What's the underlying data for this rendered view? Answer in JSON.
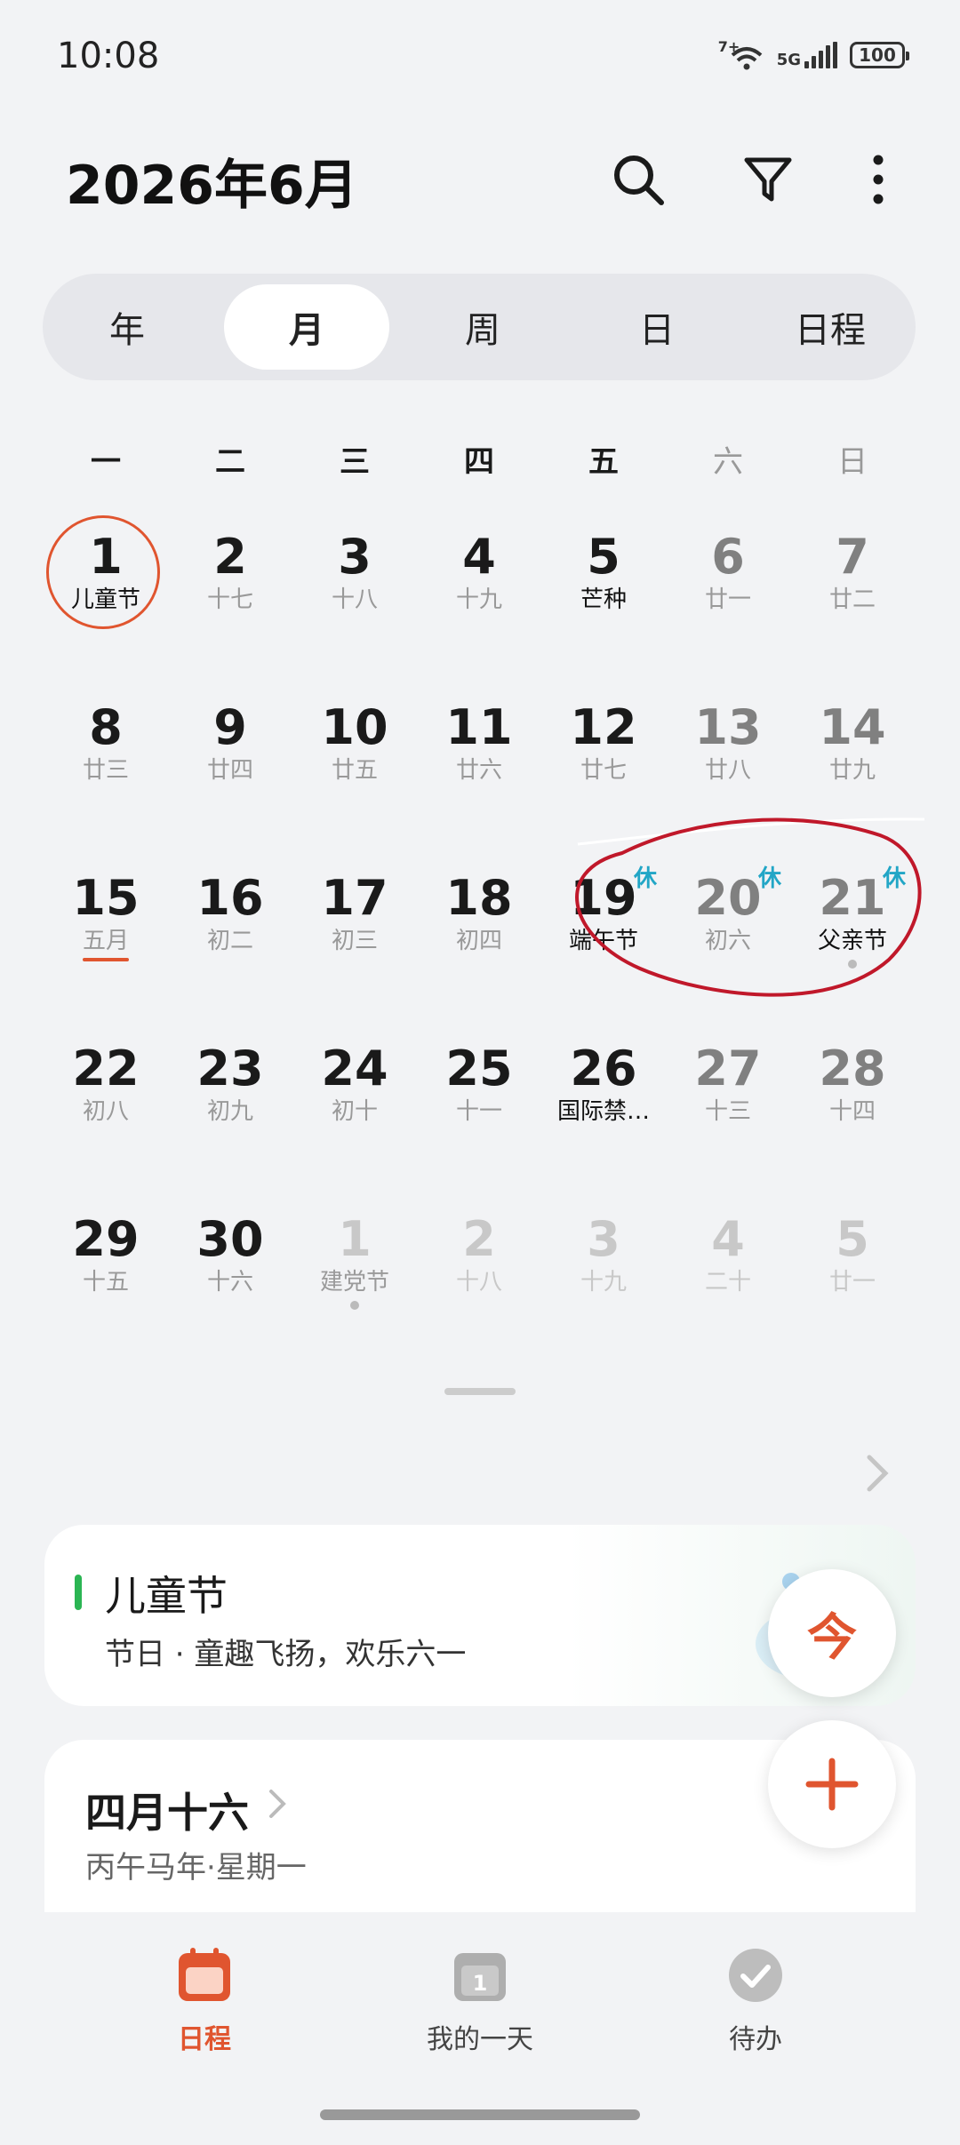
{
  "status_bar": {
    "time": "10:08",
    "wifi_sup": "7+",
    "net": "5G",
    "battery": "100"
  },
  "header": {
    "title": "2026年6月",
    "icons": [
      "search-icon",
      "filter-icon",
      "more-icon"
    ]
  },
  "view_tabs": {
    "items": [
      "年",
      "月",
      "周",
      "日",
      "日程"
    ],
    "selected": "月"
  },
  "weekdays": [
    "一",
    "二",
    "三",
    "四",
    "五",
    "六",
    "日"
  ],
  "calendar": {
    "weeks": [
      [
        {
          "day": "1",
          "sub": "儿童节",
          "sub_dark": true,
          "today": true
        },
        {
          "day": "2",
          "sub": "十七"
        },
        {
          "day": "3",
          "sub": "十八"
        },
        {
          "day": "4",
          "sub": "十九"
        },
        {
          "day": "5",
          "sub": "芒种",
          "sub_dark": true
        },
        {
          "day": "6",
          "sub": "廿一"
        },
        {
          "day": "7",
          "sub": "廿二"
        }
      ],
      [
        {
          "day": "8",
          "sub": "廿三"
        },
        {
          "day": "9",
          "sub": "廿四"
        },
        {
          "day": "10",
          "sub": "廿五"
        },
        {
          "day": "11",
          "sub": "廿六"
        },
        {
          "day": "12",
          "sub": "廿七"
        },
        {
          "day": "13",
          "sub": "廿八"
        },
        {
          "day": "14",
          "sub": "廿九"
        }
      ],
      [
        {
          "day": "15",
          "sub": "五月",
          "underline": true
        },
        {
          "day": "16",
          "sub": "初二"
        },
        {
          "day": "17",
          "sub": "初三"
        },
        {
          "day": "18",
          "sub": "初四"
        },
        {
          "day": "19",
          "sub": "端午节",
          "sub_dark": true,
          "rest": "休"
        },
        {
          "day": "20",
          "sub": "初六",
          "rest": "休"
        },
        {
          "day": "21",
          "sub": "父亲节",
          "sub_dark": true,
          "rest": "休",
          "dot": true
        }
      ],
      [
        {
          "day": "22",
          "sub": "初八"
        },
        {
          "day": "23",
          "sub": "初九"
        },
        {
          "day": "24",
          "sub": "初十"
        },
        {
          "day": "25",
          "sub": "十一"
        },
        {
          "day": "26",
          "sub": "国际禁…",
          "sub_dark": true
        },
        {
          "day": "27",
          "sub": "十三"
        },
        {
          "day": "28",
          "sub": "十四"
        }
      ],
      [
        {
          "day": "29",
          "sub": "十五"
        },
        {
          "day": "30",
          "sub": "十六"
        },
        {
          "day": "1",
          "sub": "建党节",
          "sub_dark": true,
          "other": true,
          "dot": true
        },
        {
          "day": "2",
          "sub": "十八",
          "other": true
        },
        {
          "day": "3",
          "sub": "十九",
          "other": true
        },
        {
          "day": "4",
          "sub": "二十",
          "other": true
        },
        {
          "day": "5",
          "sub": "廿一",
          "other": true
        }
      ]
    ]
  },
  "event_card": {
    "title": "儿童节",
    "desc": "节日 · 童趣飞扬，欢乐六一",
    "accent": "#2bb553"
  },
  "lunar_card": {
    "title": "四月十六",
    "desc": "丙午马年·星期一"
  },
  "fab": {
    "today_label": "今",
    "add_icon": "plus-icon"
  },
  "bottom_nav": {
    "items": [
      {
        "label": "日程",
        "icon": "calendar-icon",
        "active": true
      },
      {
        "label": "我的一天",
        "icon": "my-day-icon",
        "badge": "1"
      },
      {
        "label": "待办",
        "icon": "todo-check-icon"
      }
    ]
  },
  "colors": {
    "accent": "#e0552f",
    "rest_badge": "#22a6c6",
    "annotation": "#c0182a"
  }
}
